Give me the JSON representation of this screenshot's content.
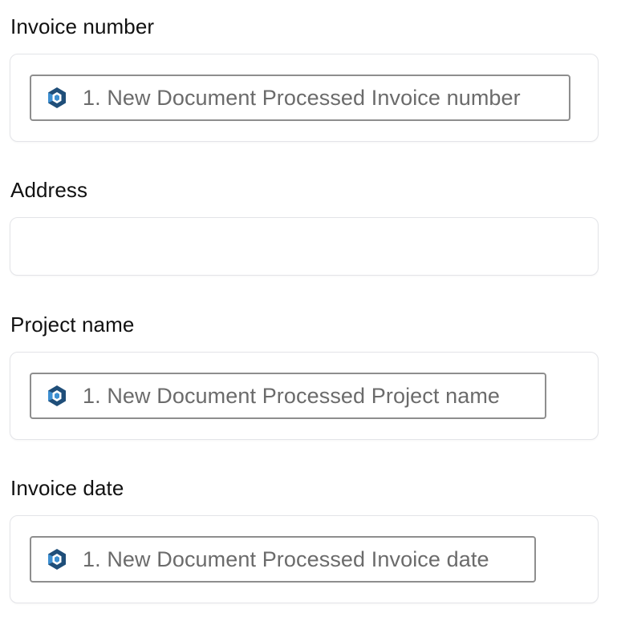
{
  "fields": [
    {
      "label": "Invoice number",
      "token": {
        "icon": "app-logo-icon",
        "text": "1. New Document Processed Invoice number"
      }
    },
    {
      "label": "Address",
      "token": null
    },
    {
      "label": "Project name",
      "token": {
        "icon": "app-logo-icon",
        "text": "1. New Document Processed Project name"
      }
    },
    {
      "label": "Invoice date",
      "token": {
        "icon": "app-logo-icon",
        "text": "1. New Document Processed Invoice date"
      }
    }
  ],
  "colors": {
    "icon_dark": "#1f4e79",
    "icon_light": "#3d8fd1"
  }
}
